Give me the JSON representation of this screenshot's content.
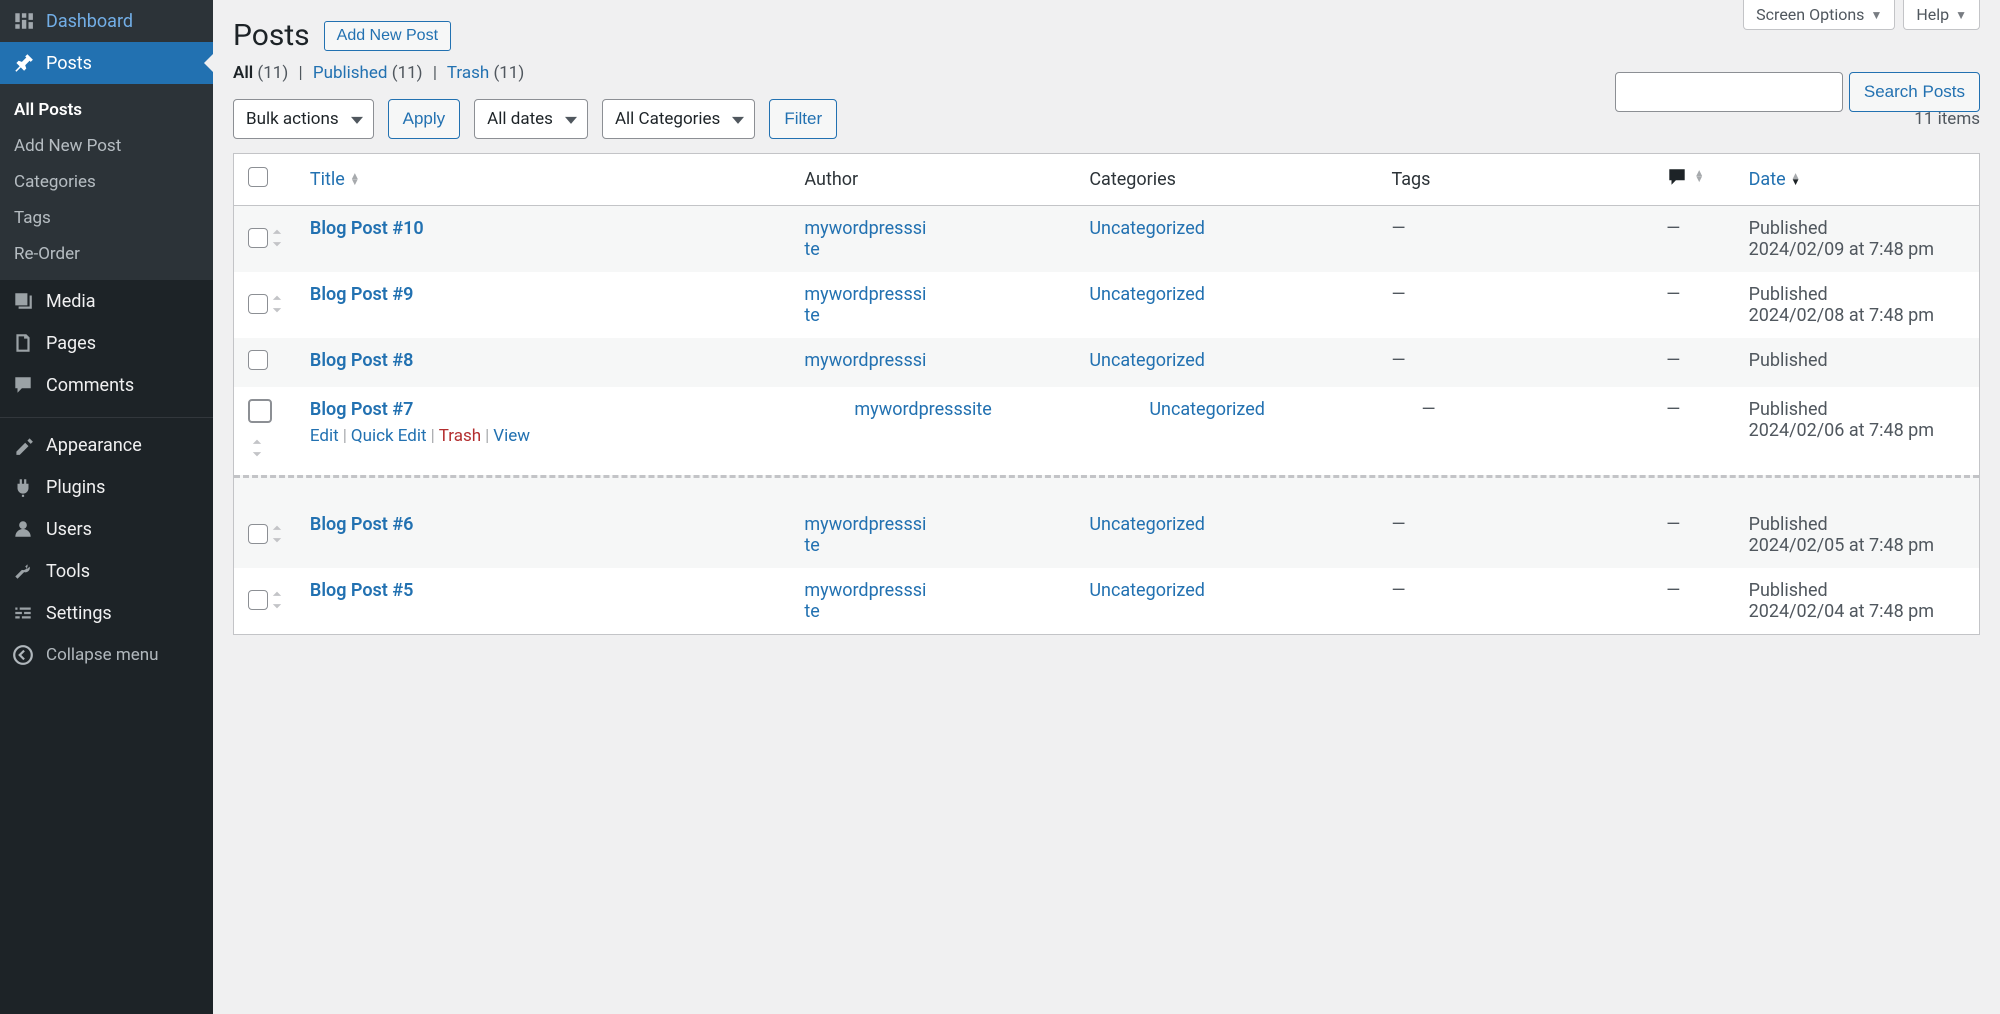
{
  "top_tabs": {
    "screen_options": "Screen Options",
    "help": "Help"
  },
  "sidebar": {
    "items": [
      {
        "icon": "dashboard",
        "label": "Dashboard"
      },
      {
        "icon": "posts",
        "label": "Posts",
        "active": true
      },
      {
        "icon": "media",
        "label": "Media"
      },
      {
        "icon": "pages",
        "label": "Pages"
      },
      {
        "icon": "comments",
        "label": "Comments"
      },
      {
        "icon": "appearance",
        "label": "Appearance"
      },
      {
        "icon": "plugins",
        "label": "Plugins"
      },
      {
        "icon": "users",
        "label": "Users"
      },
      {
        "icon": "tools",
        "label": "Tools"
      },
      {
        "icon": "settings",
        "label": "Settings"
      }
    ],
    "posts_submenu": [
      {
        "label": "All Posts",
        "current": true
      },
      {
        "label": "Add New Post"
      },
      {
        "label": "Categories"
      },
      {
        "label": "Tags"
      },
      {
        "label": "Re-Order"
      }
    ],
    "collapse_label": "Collapse menu"
  },
  "page": {
    "title": "Posts",
    "add_new_label": "Add New Post"
  },
  "filters": {
    "all_label": "All",
    "all_count": "(11)",
    "published_label": "Published",
    "published_count": "(11)",
    "trash_label": "Trash",
    "trash_count": "(11)"
  },
  "search": {
    "button": "Search Posts"
  },
  "toolbar": {
    "bulk_actions": "Bulk actions",
    "apply": "Apply",
    "all_dates": "All dates",
    "all_categories": "All Categories",
    "filter": "Filter",
    "items_count": "11 items"
  },
  "table": {
    "headers": {
      "title": "Title",
      "author": "Author",
      "categories": "Categories",
      "tags": "Tags",
      "date": "Date"
    },
    "rows": [
      {
        "title": "Blog Post #10",
        "author": "mywordpresssite",
        "author_wrap": true,
        "category": "Uncategorized",
        "tags": "—",
        "comments": "—",
        "date_status": "Published",
        "date_line": "2024/02/09 at 7:48 pm",
        "alt": true
      },
      {
        "title": "Blog Post #9",
        "author": "mywordpresssite",
        "author_wrap": true,
        "category": "Uncategorized",
        "tags": "—",
        "comments": "—",
        "date_status": "Published",
        "date_line": "2024/02/08 at 7:48 pm"
      },
      {
        "title": "Blog Post #8",
        "author": "mywordpresssi",
        "author_wrap": false,
        "category": "Uncategorized",
        "tags": "—",
        "comments": "—",
        "date_status": "Published",
        "date_line": "",
        "alt": true,
        "compact": true
      },
      {
        "title": "Blog Post #7",
        "author": "mywordpresssite",
        "author_wrap": false,
        "category": "Uncategorized",
        "tags": "—",
        "comments": "—",
        "date_status": "Published",
        "date_line": "2024/02/06 at 7:48 pm",
        "hovered": true
      },
      {
        "title": "Blog Post #6",
        "author": "mywordpresssite",
        "author_wrap": true,
        "category": "Uncategorized",
        "tags": "—",
        "comments": "—",
        "date_status": "Published",
        "date_line": "2024/02/05 at 7:48 pm",
        "alt": true
      },
      {
        "title": "Blog Post #5",
        "author": "mywordpresssite",
        "author_wrap": true,
        "category": "Uncategorized",
        "tags": "—",
        "comments": "—",
        "date_status": "Published",
        "date_line": "2024/02/04 at 7:48 pm"
      }
    ]
  },
  "row_actions": {
    "edit": "Edit",
    "quick_edit": "Quick Edit",
    "trash": "Trash",
    "view": "View"
  }
}
